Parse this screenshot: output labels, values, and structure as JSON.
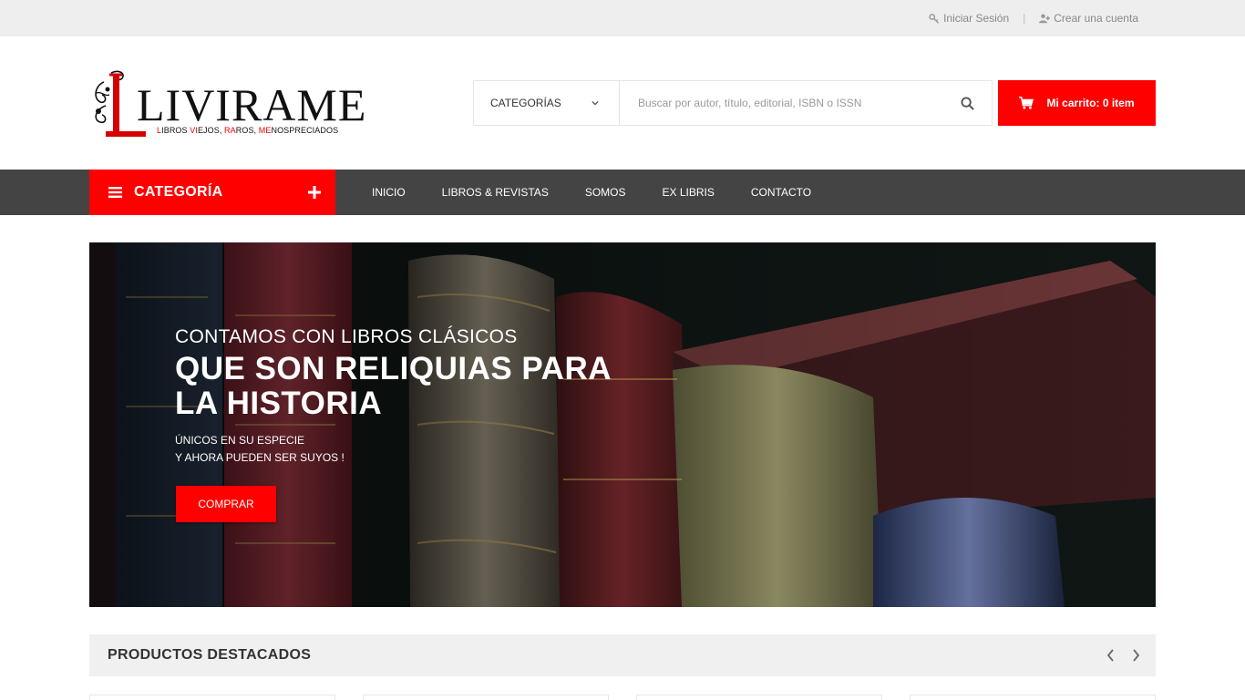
{
  "topbar": {
    "login": "Iniciar Sesión",
    "register": "Crear una cuenta",
    "separator": "|"
  },
  "logo": {
    "wordmark": "LIVIRAME",
    "tagline_parts": [
      "L",
      "IBROS ",
      "VI",
      "EJOS, ",
      "RA",
      "ROS, ",
      "ME",
      "NOSPRECIADOS"
    ]
  },
  "search": {
    "category_label": "CATEGORÍAS",
    "placeholder": "Buscar por autor, título, editorial, ISBN o ISSN"
  },
  "cart": {
    "label": "Mi carrito: 0 item"
  },
  "nav": {
    "category_button": "CATEGORÍA",
    "items": [
      "INICIO",
      "LIBROS & REVISTAS",
      "SOMOS",
      "EX LIBRIS",
      "CONTACTO"
    ]
  },
  "hero": {
    "line1": "CONTAMOS CON LIBROS CLÁSICOS",
    "line2": "QUE SON RELIQUIAS PARA LA HISTORIA",
    "line3a": "ÚNICOS EN SU ESPECIE",
    "line3b": "Y AHORA PUEDEN SER SUYOS !",
    "button": "COMPRAR"
  },
  "featured": {
    "title": "PRODUCTOS DESTACADOS"
  },
  "colors": {
    "accent": "#ff0000",
    "nav_bg": "#444444",
    "topbar_bg": "#eeeeee"
  }
}
